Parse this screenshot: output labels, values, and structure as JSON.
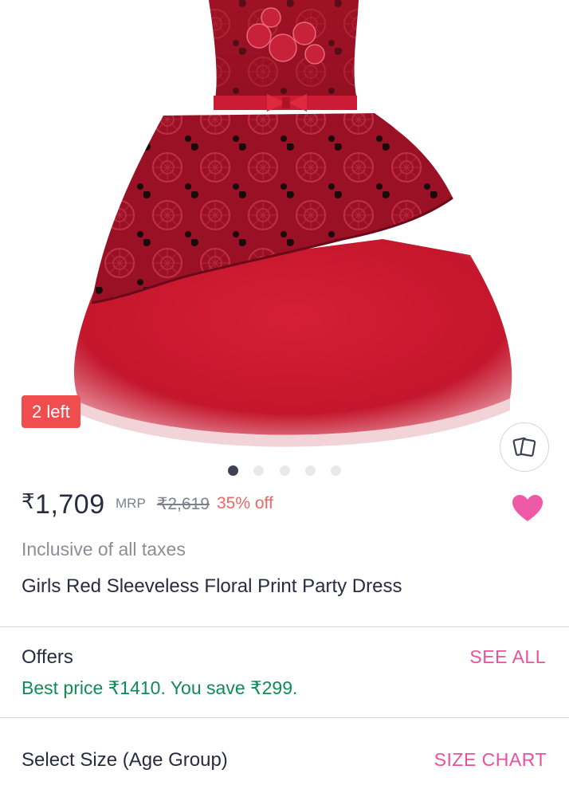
{
  "product": {
    "stock_badge": "2 left",
    "price_symbol": "₹",
    "price": "1,709",
    "mrp_label": "MRP",
    "mrp_value": "₹2,619",
    "discount": "35% off",
    "tax_note": "Inclusive of all taxes",
    "title": "Girls Red Sleeveless Floral Print Party Dress"
  },
  "carousel": {
    "image_count": 5,
    "active_index": 0
  },
  "offers": {
    "title": "Offers",
    "see_all": "SEE ALL",
    "text": "Best price ₹1410. You save ₹299."
  },
  "size": {
    "title": "Select Size (Age Group)",
    "chart_link": "SIZE CHART"
  },
  "icons": {
    "similar": "similar-products-icon",
    "wishlist": "heart-icon"
  },
  "colors": {
    "wishlist_heart": "#ee5aa6",
    "link_pink": "#e9509d",
    "offer_green": "#0f8b55",
    "badge_red": "#f04e4e",
    "discount_red": "#f16565"
  }
}
